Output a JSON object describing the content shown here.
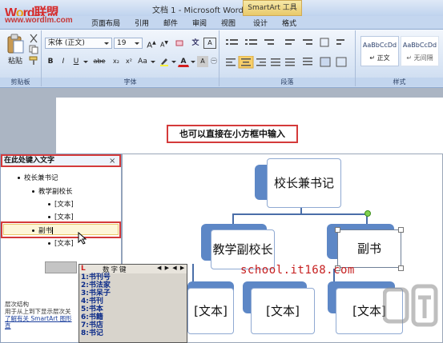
{
  "window": {
    "logo": "Word联盟",
    "logo_url": "www.wordlm.com",
    "doc_title": "文档 1 - Microsoft Word",
    "context_tab": "SmartArt 工具"
  },
  "tabs": [
    "页面布局",
    "引用",
    "邮件",
    "审阅",
    "视图",
    "设计",
    "格式"
  ],
  "ribbon": {
    "clipboard": {
      "paste_label": "粘贴",
      "group_label": "剪贴板"
    },
    "font": {
      "font_name": "宋体 (正文)",
      "font_size": "19",
      "group_label": "字体",
      "bold": "B",
      "italic": "I",
      "underline": "U",
      "strike": "abe",
      "sub": "x₂",
      "sup": "x²",
      "aa": "Aa",
      "color_a": "A"
    },
    "paragraph": {
      "group_label": "段落"
    },
    "styles": {
      "group_label": "样式",
      "items": [
        {
          "preview": "AaBbCcDd",
          "name": "↵ 正文"
        },
        {
          "preview": "AaBbCcDd",
          "name": "↵ 无间隔"
        }
      ]
    }
  },
  "document": {
    "caption": "也可以直接在小方框中输入"
  },
  "text_pane": {
    "header": "在此处键入文字",
    "close": "×",
    "items": [
      {
        "level": 1,
        "text": "校长兼书记"
      },
      {
        "level": 2,
        "text": "教学副校长"
      },
      {
        "level": 3,
        "text": "[文本]"
      },
      {
        "level": 3,
        "text": "[文本]"
      },
      {
        "level": 2,
        "text": "副书"
      },
      {
        "level": 3,
        "text": "[文本]"
      }
    ],
    "desc_title": "层次结构",
    "desc_line": "用于从上到下显示层次关",
    "desc_link": "了解有关 SmartArt 图形",
    "desc_end": "直"
  },
  "smartart": {
    "top": "校长兼书记",
    "left": "教学副校长",
    "right": "副书",
    "child1": "[文本]",
    "child2": "[文本]",
    "child3": "[文本]"
  },
  "watermark": "school.it168.com",
  "ime": {
    "logo": "L",
    "name": "数字键",
    "arrows": "◀ ▶ ◀ ▶",
    "candidates": [
      "1:书刊号",
      "2:书法家",
      "3:书呆子",
      "4:书刊",
      "5:书本",
      "6:书籍",
      "7:书店",
      "8:书记"
    ]
  }
}
